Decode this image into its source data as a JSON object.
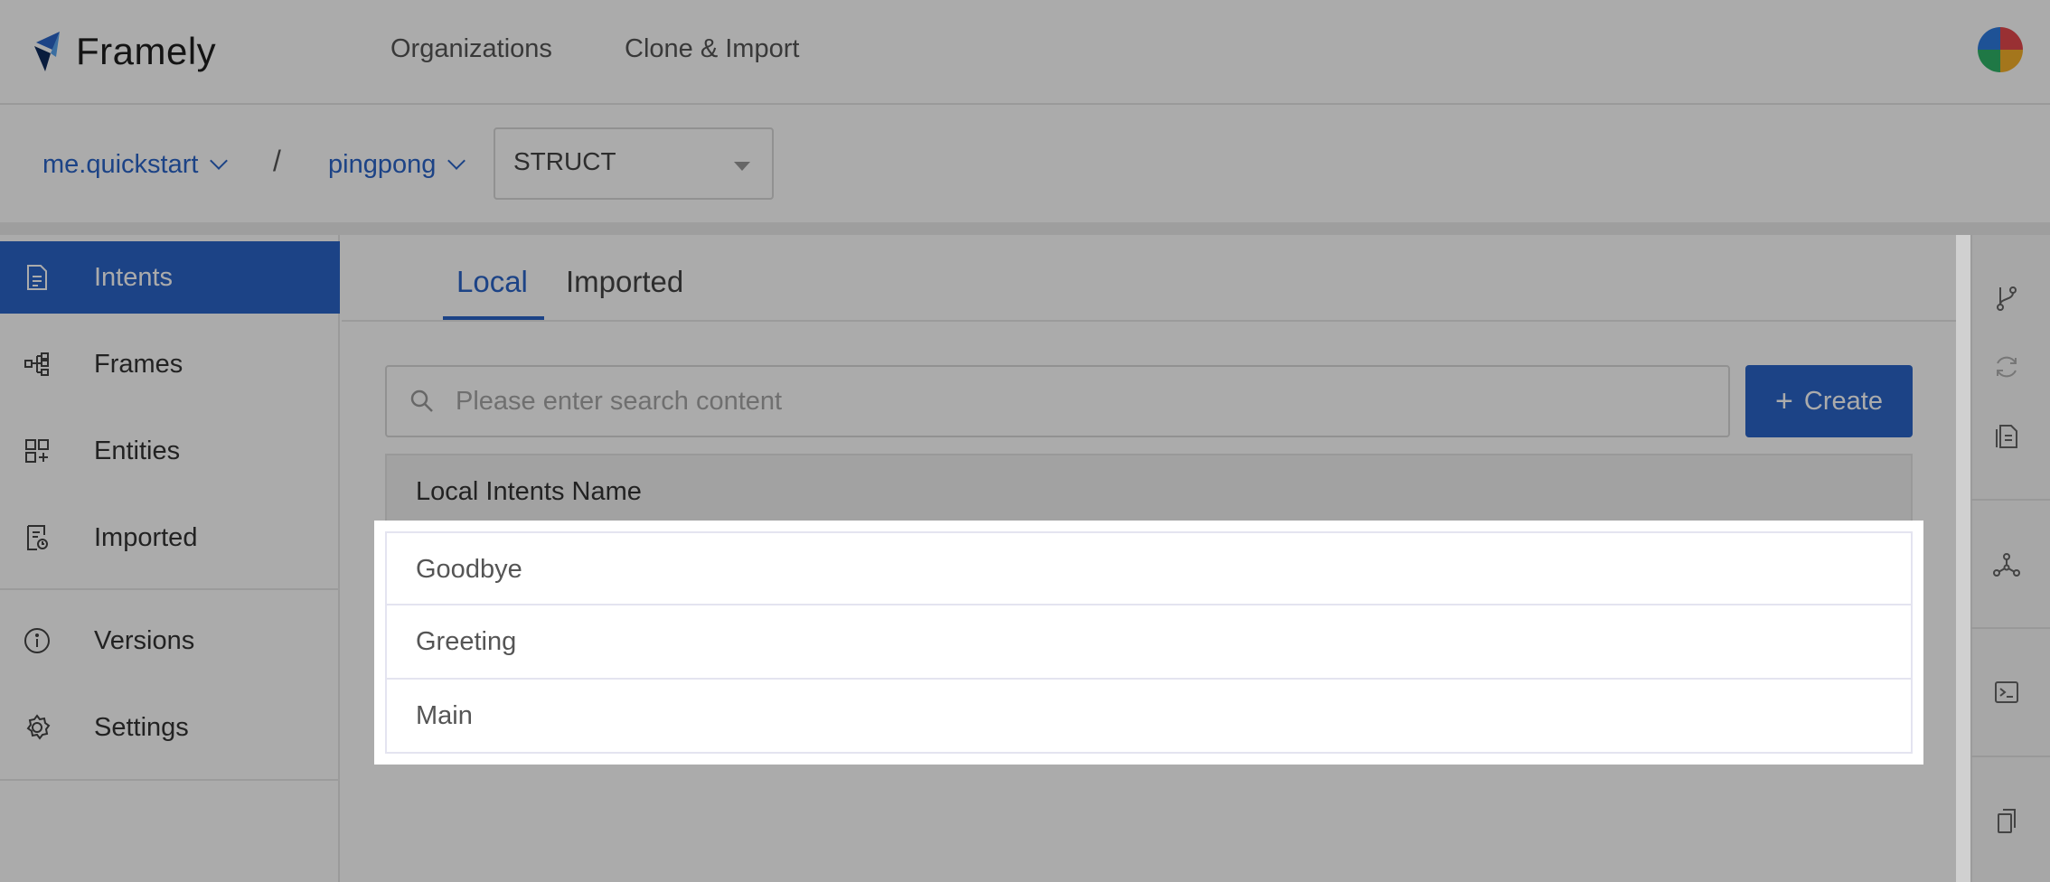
{
  "app": {
    "name": "Framely"
  },
  "header": {
    "nav": [
      {
        "label": "Organizations"
      },
      {
        "label": "Clone & Import"
      }
    ]
  },
  "breadcrumb": {
    "org": "me.quickstart",
    "separator": "/",
    "project": "pingpong",
    "mode_select": "STRUCT"
  },
  "sidebar": {
    "items": [
      {
        "label": "Intents",
        "icon": "document-icon",
        "active": true
      },
      {
        "label": "Frames",
        "icon": "frames-icon"
      },
      {
        "label": "Entities",
        "icon": "entities-icon"
      },
      {
        "label": "Imported",
        "icon": "imported-icon"
      },
      {
        "label": "Versions",
        "icon": "info-icon"
      },
      {
        "label": "Settings",
        "icon": "gear-icon"
      }
    ]
  },
  "tabs": [
    {
      "label": "Local",
      "active": true
    },
    {
      "label": "Imported"
    }
  ],
  "search": {
    "placeholder": "Please enter search content",
    "value": ""
  },
  "create_button": {
    "label": "Create"
  },
  "table": {
    "header": "Local Intents Name",
    "rows": [
      "Goodbye",
      "Greeting",
      "Main"
    ]
  },
  "right_rail": {
    "icons": [
      "branch-icon",
      "refresh-icon",
      "file-icon",
      "graph-icon",
      "terminal-icon",
      "copy-icon"
    ]
  },
  "colors": {
    "accent": "#2a64c8",
    "overlay": "rgba(0,0,0,0.33)"
  }
}
